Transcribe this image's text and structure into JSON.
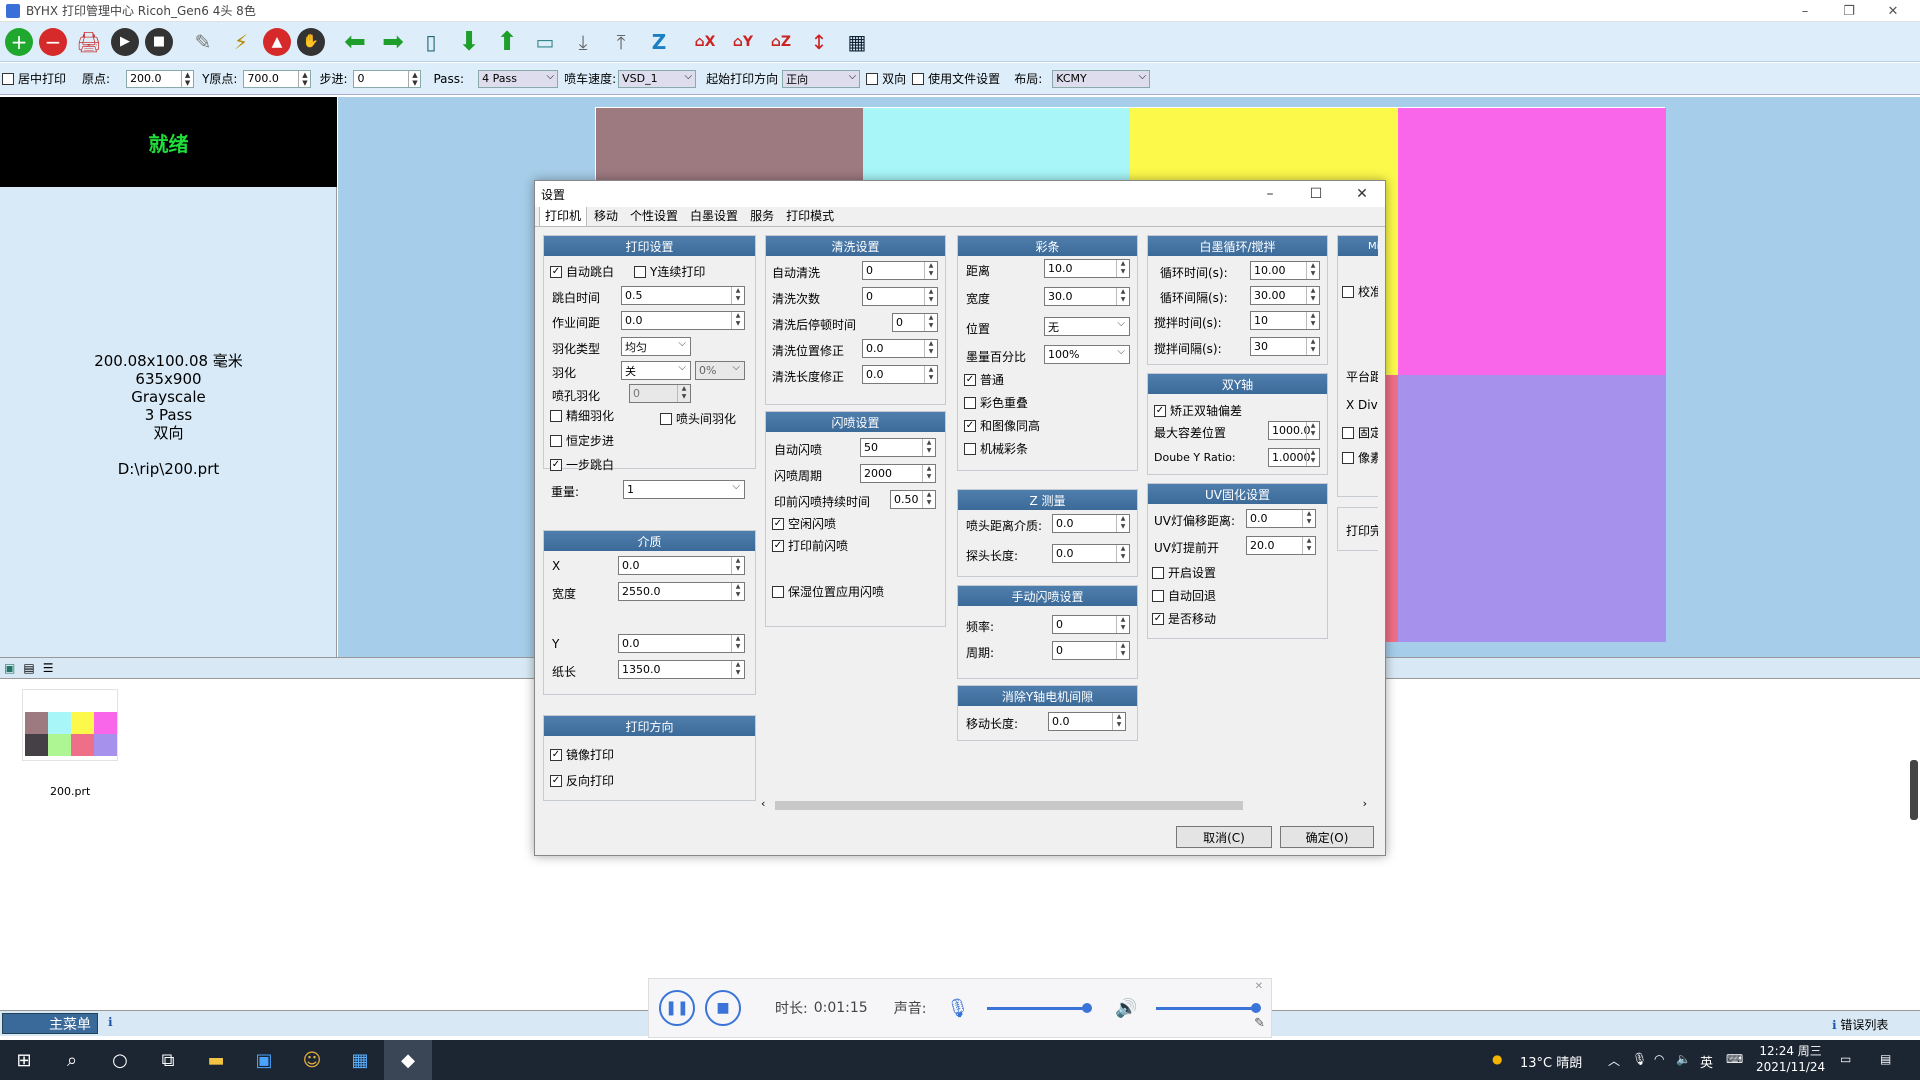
{
  "window": {
    "title": "BYHX  打印管理中心 Ricoh_Gen6 4头 8色"
  },
  "toolbar": {
    "icons": [
      "add-icon",
      "remove-icon",
      "print-icon",
      "play-icon",
      "stop-icon",
      "clean-icon",
      "flash-icon",
      "abort-icon",
      "pause-icon",
      "left-arrow-icon",
      "right-arrow-icon",
      "measure-icon",
      "down-icon",
      "up-icon",
      "carriage-icon",
      "feed-icon",
      "unfeed-icon",
      "z-icon",
      "home-x-icon",
      "home-y-icon",
      "home-z-icon",
      "measure-paper-icon",
      "settings-grid-icon"
    ]
  },
  "options": {
    "center_print": "居中打印",
    "origin_label": "原点:",
    "origin_value": "200.0",
    "y_origin_label": "Y原点:",
    "y_origin_value": "700.0",
    "step_label": "步进:",
    "step_value": "0",
    "pass_label": "Pass:",
    "pass_value": "4 Pass",
    "speed_label": "喷车速度:",
    "speed_value": "VSD_1",
    "direction_label": "起始打印方向",
    "direction_value": "正向",
    "bidir": "双向",
    "use_file_settings": "使用文件设置",
    "layout_label": "布局:",
    "layout_value": "KCMY"
  },
  "status": {
    "ready": "就绪",
    "job_lines": [
      "200.08x100.08 毫米",
      "635x900",
      "Grayscale",
      "3 Pass",
      "双向",
      "",
      "D:\\rip\\200.prt"
    ]
  },
  "colors": {
    "bar1": "#9d7980",
    "bar2": "#a8f6f8",
    "bar3": "#fdf94a",
    "bar4": "#f966ea",
    "bar5": "#454045",
    "bar6": "#aef593",
    "bar7": "#ef6f88",
    "bar8": "#a691ec"
  },
  "thumbs": {
    "file_name": "200.prt"
  },
  "statusbar": {
    "main_menu": "主菜单",
    "error_list": "错误列表"
  },
  "player": {
    "duration_label": "时长:",
    "duration": "0:01:15",
    "volume_label": "声音:"
  },
  "taskbar": {
    "weather": "13°C 晴朗",
    "ime": "英",
    "time": "12:24 周三",
    "date": "2021/11/24"
  },
  "dialog": {
    "title": "设置",
    "tabs": [
      "打印机",
      "移动",
      "个性设置",
      "白墨设置",
      "服务",
      "打印模式"
    ],
    "print_settings": {
      "header": "打印设置",
      "auto_skip_white": "自动跳白",
      "y_continuous": "Y连续打印",
      "skip_time_label": "跳白时间",
      "skip_time": "0.5",
      "job_spacing_label": "作业间距",
      "job_spacing": "0.0",
      "feather_type_label": "羽化类型",
      "feather_type": "均匀",
      "feather_label": "羽化",
      "feather": "关",
      "feather_pct": "0%",
      "nozzle_feather_label": "喷孔羽化",
      "nozzle_feather": "0",
      "fine_feather": "精细羽化",
      "head_feather": "喷头间羽化",
      "constant_step": "恒定步进",
      "one_step_skip": "一步跳白",
      "weight_label": "重量:",
      "weight": "1"
    },
    "media": {
      "header": "介质",
      "x_label": "X",
      "x": "0.0",
      "width_label": "宽度",
      "width": "2550.0",
      "y_label": "Y",
      "y": "0.0",
      "length_label": "纸长",
      "length": "1350.0"
    },
    "print_dir": {
      "header": "打印方向",
      "mirror": "镜像打印",
      "reverse": "反向打印"
    },
    "clean": {
      "header": "清洗设置",
      "auto_label": "自动清洗",
      "auto": "0",
      "count_label": "清洗次数",
      "count": "0",
      "pause_label": "清洗后停顿时间",
      "pause": "0",
      "pos_label": "清洗位置修正",
      "pos": "0.0",
      "len_label": "清洗长度修正",
      "len": "0.0"
    },
    "flash": {
      "header": "闪喷设置",
      "auto_label": "自动闪喷",
      "auto": "50",
      "period_label": "闪喷周期",
      "period": "2000",
      "pre_label": "印前闪喷持续时间",
      "pre": "0.50",
      "idle": "空闲闪喷",
      "before": "打印前闪喷",
      "moist": "保湿位置应用闪喷"
    },
    "color_bar": {
      "header": "彩条",
      "dist_label": "距离",
      "dist": "10.0",
      "width_label": "宽度",
      "width": "30.0",
      "pos_label": "位置",
      "pos": "无",
      "ink_label": "墨量百分比",
      "ink": "100%",
      "normal": "普通",
      "overlap": "彩色重叠",
      "same_height": "和图像同高",
      "mech": "机械彩条"
    },
    "z": {
      "header": "Z 测量",
      "head_dist_label": "喷头距离介质:",
      "head_dist": "0.0",
      "probe_label": "探头长度:",
      "probe": "0.0"
    },
    "manual_flash": {
      "header": "手动闪喷设置",
      "freq_label": "频率:",
      "freq": "0",
      "period_label": "周期:",
      "period": "0"
    },
    "yclear": {
      "header": "消除Y轴电机间隙",
      "move_label": "移动长度:",
      "move": "0.0"
    },
    "white": {
      "header": "白墨循环/搅拌",
      "cycle_time_label": "循环时间(s):",
      "cycle_time": "10.00",
      "cycle_int_label": "循环间隔(s):",
      "cycle_int": "30.00",
      "stir_time_label": "搅拌时间(s):",
      "stir_time": "10",
      "stir_int_label": "搅拌间隔(s):",
      "stir_int": "30"
    },
    "dual_y": {
      "header": "双Y轴",
      "correct": "矫正双轴偏差",
      "max_label": "最大容差位置",
      "max": "1000.0",
      "ratio_label": "Doube Y Ratio:",
      "ratio": "1.0000"
    },
    "uv": {
      "header": "UV固化设置",
      "offset_label": "UV灯偏移距离:",
      "offset": "0.0",
      "advance_label": "UV灯提前开",
      "advance": "20.0",
      "open": "开启设置",
      "auto_back": "自动回退",
      "move": "是否移动"
    },
    "misc": {
      "header": "Mis",
      "calib": "校准",
      "platform": "平台距",
      "xdiv": "X Div:",
      "fixed": "固定",
      "pixel": "像素",
      "print_done": "打印完"
    },
    "cancel": "取消(C)",
    "ok": "确定(O)"
  }
}
